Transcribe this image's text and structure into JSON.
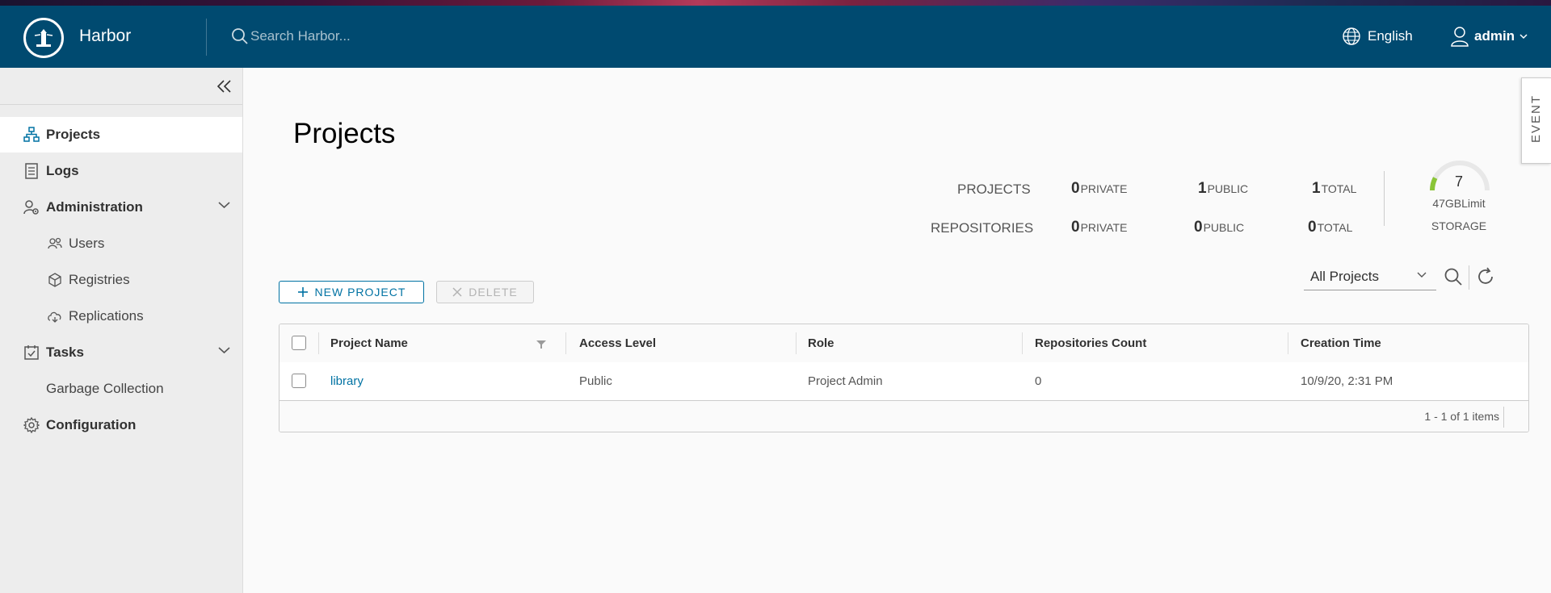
{
  "app": {
    "name": "Harbor"
  },
  "search": {
    "placeholder": "Search Harbor..."
  },
  "header": {
    "language": "English",
    "user": "admin"
  },
  "sidebar": {
    "items": [
      {
        "label": "Projects",
        "icon": "projects-icon",
        "active": true
      },
      {
        "label": "Logs",
        "icon": "logs-icon"
      },
      {
        "label": "Administration",
        "icon": "administration-icon",
        "expanded": true
      },
      {
        "label": "Users",
        "icon": "users-icon"
      },
      {
        "label": "Registries",
        "icon": "registries-icon"
      },
      {
        "label": "Replications",
        "icon": "replications-icon"
      },
      {
        "label": "Tasks",
        "icon": "tasks-icon",
        "expanded": true
      },
      {
        "label": "Garbage Collection"
      },
      {
        "label": "Configuration",
        "icon": "gear-icon"
      }
    ]
  },
  "page": {
    "title": "Projects"
  },
  "stats": {
    "projects": {
      "label": "PROJECTS",
      "private": "0",
      "public": "1",
      "total": "1"
    },
    "repositories": {
      "label": "REPOSITORIES",
      "private": "0",
      "public": "0",
      "total": "0"
    },
    "private_label": "PRIVATE",
    "public_label": "PUBLIC",
    "total_label": "TOTAL"
  },
  "storage": {
    "value": "7",
    "limit": "47GBLimit",
    "label": "STORAGE",
    "used_fraction": 0.15,
    "accent": "#8ac537"
  },
  "toolbar": {
    "new_project": "NEW PROJECT",
    "delete": "DELETE",
    "filter_value": "All Projects"
  },
  "table": {
    "headers": [
      "Project Name",
      "Access Level",
      "Role",
      "Repositories Count",
      "Creation Time"
    ],
    "rows": [
      {
        "name": "library",
        "access": "Public",
        "role": "Project Admin",
        "repo_count": "0",
        "created": "10/9/20, 2:31 PM"
      }
    ],
    "pagination": "1 - 1 of 1 items"
  },
  "event_tab": {
    "label": "EVENT"
  },
  "colors": {
    "header_bg": "#004a70",
    "accent": "#0072a3",
    "sidebar_bg": "#ededed"
  }
}
